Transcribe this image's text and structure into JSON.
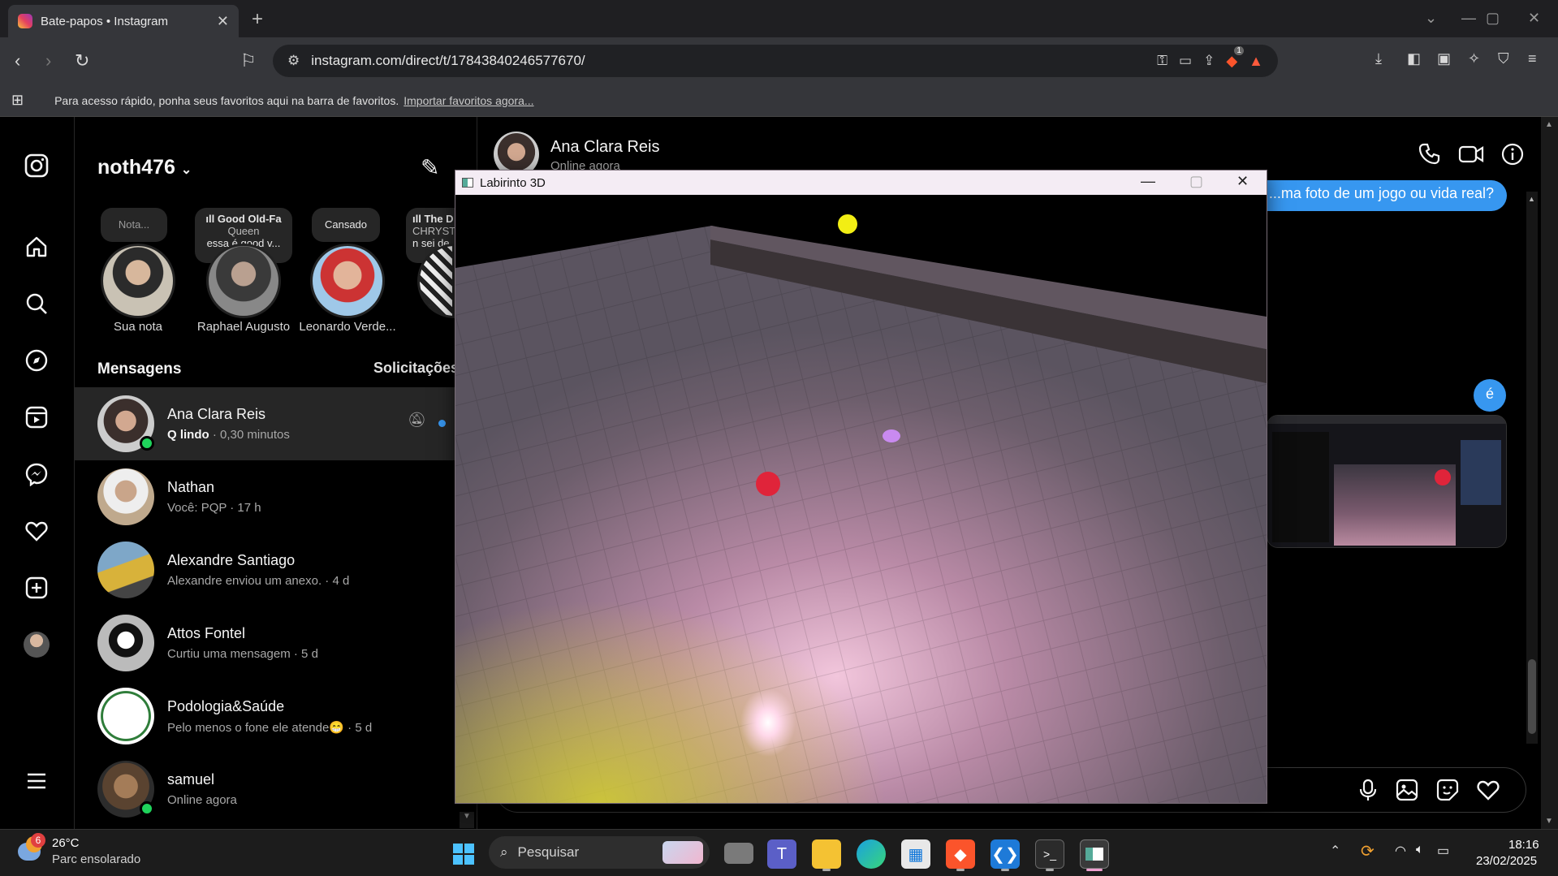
{
  "browser": {
    "tab_title": "Bate-papos • Instagram",
    "url": "instagram.com/direct/t/17843840246577670/",
    "bookmarks_hint": "Para acesso rápido, ponha seus favoritos aqui na barra de favoritos.",
    "bookmarks_link": "Importar favoritos agora...",
    "brave_badge": "1"
  },
  "inbox": {
    "username": "noth476",
    "notes": [
      {
        "note": "Nota...",
        "name": "Sua nota"
      },
      {
        "note_title": "ıll Good Old-Fa",
        "note_sub": "Queen",
        "note_text": "essa é good v...",
        "name": "Raphael Augusto"
      },
      {
        "note": "Cansado",
        "name": "Leonardo Verde..."
      },
      {
        "note_title": "ıll The D",
        "note_sub": "CHRYST",
        "note_text": "n sei de"
      }
    ],
    "messages_heading": "Mensagens",
    "requests_label": "Solicitações",
    "conversations": [
      {
        "name": "Ana Clara Reis",
        "preview_bold": "Q lindo",
        "preview": "· 0,30 minutos",
        "online": true,
        "muted": true,
        "unread": true
      },
      {
        "name": "Nathan",
        "preview": "Você: PQP · 17 h"
      },
      {
        "name": "Alexandre Santiago",
        "preview": "Alexandre enviou um anexo. · 4 d"
      },
      {
        "name": "Attos Fontel",
        "preview": "Curtiu uma mensagem · 5 d"
      },
      {
        "name": "Podologia&Saúde",
        "preview": "Pelo menos o fone ele atende😁 · 5 d"
      },
      {
        "name": "samuel",
        "preview": "Online agora",
        "online": true
      }
    ]
  },
  "chat": {
    "contact_name": "Ana Clara Reis",
    "contact_status": "Online agora",
    "bubble_partial": "...ma foto de um jogo ou vida real?",
    "bubble_e": "é"
  },
  "game_window": {
    "title": "Labirinto 3D"
  },
  "taskbar": {
    "weather_temp": "26°C",
    "weather_desc": "Parc ensolarado",
    "weather_badge": "6",
    "search_placeholder": "Pesquisar",
    "time": "18:16",
    "date": "23/02/2025"
  },
  "colors": {
    "accent": "#3797f0",
    "online": "#1fd35b",
    "yellow_sphere": "#f2ee14",
    "red_sphere": "#e0243a",
    "violet_sphere": "#c98af0"
  }
}
